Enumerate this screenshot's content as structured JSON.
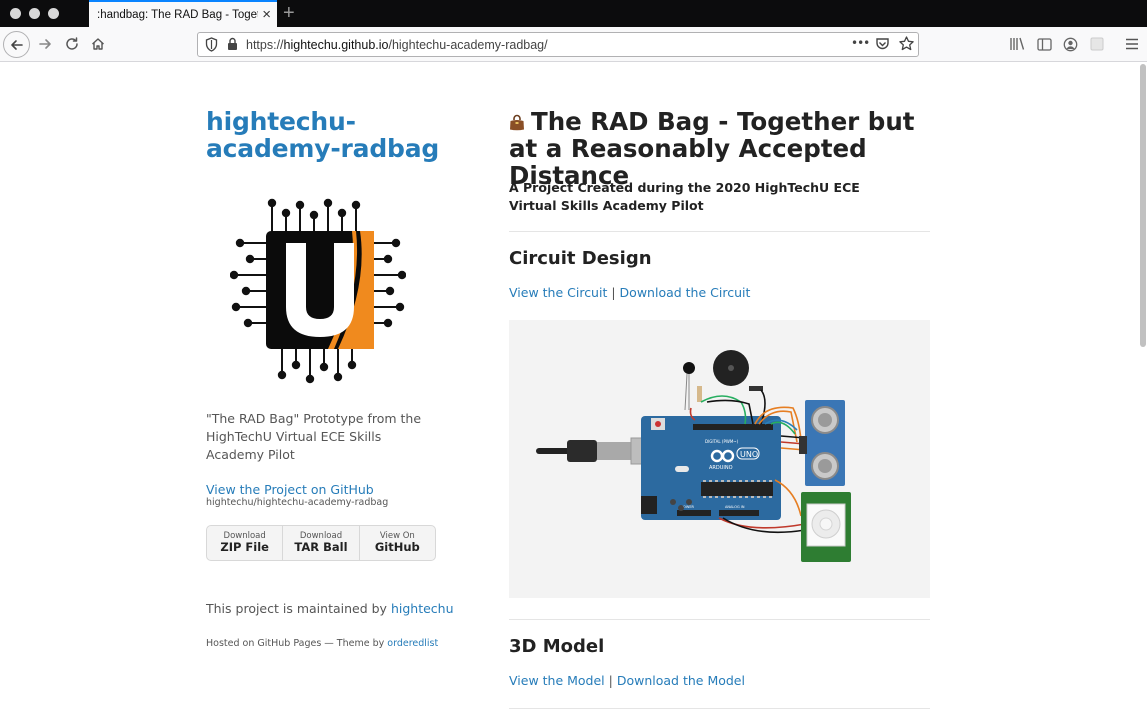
{
  "browser": {
    "tab_title": ":handbag: The RAD Bag - Together",
    "tab_close": "×",
    "new_tab": "+",
    "url_scheme": "https://",
    "url_host": "hightechu.github.io",
    "url_path": "/hightechu-academy-radbag/",
    "page_actions": "•••"
  },
  "sidebar": {
    "title": "hightechu-academy-radbag",
    "description": "\"The RAD Bag\" Prototype from the HighTechU Virtual ECE Skills Academy Pilot",
    "repo_link": "View the Project on GitHub",
    "repo_path": "hightechu/hightechu-academy-radbag",
    "downloads": [
      {
        "small": "Download",
        "big": "ZIP File"
      },
      {
        "small": "Download",
        "big": "TAR Ball"
      },
      {
        "small": "View On",
        "big": "GitHub"
      }
    ],
    "maintained_prefix": "This project is maintained by ",
    "maintainer": "hightechu",
    "hosted_prefix": "Hosted on GitHub Pages — Theme by ",
    "theme_author": "orderedlist"
  },
  "content": {
    "title": "The RAD Bag - Together but at a Reasonably Accepted Distance",
    "subtitle": "A Project Created during the 2020 HighTechU ECE Virtual Skills Academy Pilot",
    "sections": [
      {
        "heading": "Circuit Design",
        "link1": "View the Circuit",
        "separator": "|",
        "link2": "Download the Circuit"
      },
      {
        "heading": "3D Model",
        "link1": "View the Model",
        "separator": "|",
        "link2": "Download the Model"
      }
    ],
    "circuit_image": {
      "board_brand": "ARDUINO",
      "board_model": "UNO",
      "board_header_label": "DIGITAL (PWM~)",
      "board_power_label": "POWER",
      "board_analog_label": "ANALOG IN"
    }
  },
  "colors": {
    "link": "#267CB9",
    "tab_accent": "#0a84ff",
    "logo_orange": "#F08A1E",
    "arduino_blue": "#2C6AA0"
  }
}
